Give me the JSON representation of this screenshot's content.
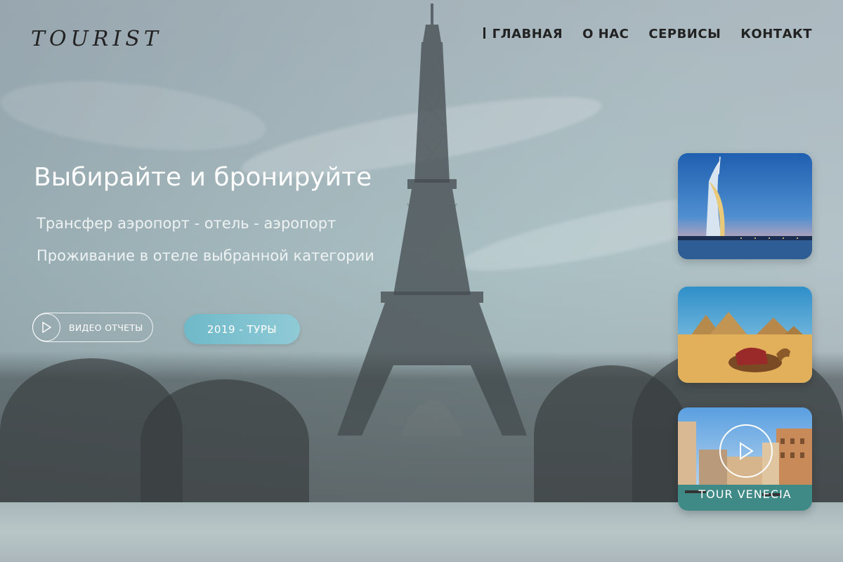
{
  "brand": {
    "logo_text": "TOURIST"
  },
  "nav": {
    "items": [
      {
        "label": "ГЛАВНАЯ",
        "active": true
      },
      {
        "label": "О НАС",
        "active": false
      },
      {
        "label": "СЕРВИСЫ",
        "active": false
      },
      {
        "label": "КОНТАКТ",
        "active": false
      }
    ]
  },
  "hero": {
    "title": "Выбирайте и бронируйте",
    "lines": [
      "Трансфер аэропорт - отель - аэропорт",
      "Проживание в отеле выбранной категории"
    ]
  },
  "buttons": {
    "video_reports": "ВИДЕО ОТЧЕТЫ",
    "tours_2019": "2019  -  ТУРЫ"
  },
  "cards": [
    {
      "scene": "dubai-burj-al-arab",
      "caption": ""
    },
    {
      "scene": "egypt-pyramids-camel",
      "caption": ""
    },
    {
      "scene": "venice-canal",
      "caption": "TOUR  VENECIA"
    }
  ],
  "icons": {
    "play": "play-icon"
  },
  "colors": {
    "accent": "#7fc2d0",
    "nav_text": "#222222",
    "hero_text": "#ffffff"
  }
}
